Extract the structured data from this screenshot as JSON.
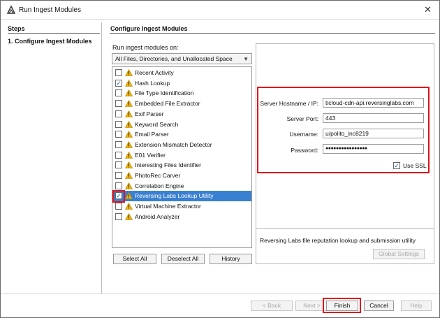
{
  "window": {
    "title": "Run Ingest Modules",
    "close_glyph": "✕"
  },
  "steps": {
    "heading": "Steps",
    "items": [
      "1.   Configure Ingest Modules"
    ]
  },
  "config": {
    "heading": "Configure Ingest Modules",
    "run_on_label": "Run ingest modules on:",
    "run_on_value": "All Files, Directories, and Unallocated Space",
    "modules": [
      {
        "label": "Recent Activity",
        "checked": false
      },
      {
        "label": "Hash Lookup",
        "checked": true
      },
      {
        "label": "File Type Identification",
        "checked": false
      },
      {
        "label": "Embedded File Extractor",
        "checked": false
      },
      {
        "label": "Exif Parser",
        "checked": false
      },
      {
        "label": "Keyword Search",
        "checked": false
      },
      {
        "label": "Email Parser",
        "checked": false
      },
      {
        "label": "Extension Mismatch Detector",
        "checked": false
      },
      {
        "label": "E01 Verifier",
        "checked": false
      },
      {
        "label": "Interesting Files Identifier",
        "checked": false
      },
      {
        "label": "PhotoRec Carver",
        "checked": false
      },
      {
        "label": "Correlation Engine",
        "checked": false
      },
      {
        "label": "Reversing Labs Lookup Utility",
        "checked": true,
        "selected": true
      },
      {
        "label": "Virtual Machine Extractor",
        "checked": false
      },
      {
        "label": "Android Analyzer",
        "checked": false
      }
    ],
    "select_all": "Select All",
    "deselect_all": "Deselect All",
    "history": "History"
  },
  "settings": {
    "hostname_label": "Server Hostname / IP:",
    "hostname_value": "ticloud-cdn-api.reversinglabs.com",
    "port_label": "Server Port:",
    "port_value": "443",
    "username_label": "Username:",
    "username_value": "u/polito_inc8219",
    "password_label": "Password:",
    "password_value": "●●●●●●●●●●●●●●●●",
    "use_ssl_label": "Use SSL",
    "use_ssl_checked": true,
    "description": "Reversing Labs file reputation lookup and submission utility",
    "global_settings": "Global Settings"
  },
  "footer": {
    "back": "< Back",
    "next": "Next >",
    "finish": "Finish",
    "cancel": "Cancel",
    "help": "Help"
  },
  "colors": {
    "accent_selection": "#3a80d2",
    "highlight": "#e0131b",
    "warning": "#f0b400"
  },
  "icons": [
    "app-icon",
    "warning-icon",
    "checkbox-icon",
    "close-icon",
    "chevron-down-icon"
  ]
}
